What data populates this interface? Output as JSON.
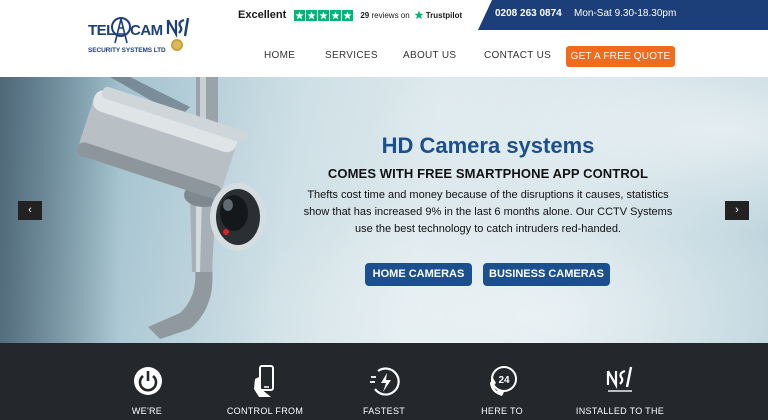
{
  "logo": {
    "word1": "TEL",
    "word2": "CAM",
    "tagline": "SECURITY SYSTEMS LTD"
  },
  "trustpilot": {
    "rating_word": "Excellent",
    "stars": 5,
    "reviews_count": "29",
    "reviews_text": "reviews on",
    "brand": "Trustpilot"
  },
  "topbar": {
    "phone": "0208 263 0874",
    "hours": "Mon-Sat 9.30-18.30pm"
  },
  "nav": {
    "home": "HOME",
    "services": "SERVICES",
    "about": "ABOUT US",
    "contact": "CONTACT US"
  },
  "cta": {
    "quote": "GET A FREE QUOTE"
  },
  "hero": {
    "title": "HD Camera systems",
    "subtitle": "COMES WITH FREE SMARTPHONE APP CONTROL",
    "body": "Thefts cost time and money because of the disruptions it causes, statistics show that has increased 9% in the last 6 months alone. Our CCTV Systems use the best technology to catch intruders red-handed.",
    "btn_home": "HOME CAMERAS",
    "btn_business": "BUSINESS CAMERAS"
  },
  "slider": {
    "prev": "‹",
    "next": "›"
  },
  "features": [
    {
      "label": "WE'RE",
      "icon": "power-icon"
    },
    {
      "label": "CONTROL FROM",
      "icon": "smartphone-hand-icon"
    },
    {
      "label": "FASTEST",
      "icon": "fast-clock-icon"
    },
    {
      "label": "HERE TO",
      "icon": "24-hour-phone-icon"
    },
    {
      "label": "INSTALLED TO THE",
      "icon": "nsi-approved-icon"
    }
  ],
  "colors": {
    "brand_blue": "#1c4f8e",
    "navy": "#1c3f7a",
    "orange": "#f26b1d",
    "dark_strip": "#24272c",
    "trustpilot_green": "#00b67a"
  }
}
